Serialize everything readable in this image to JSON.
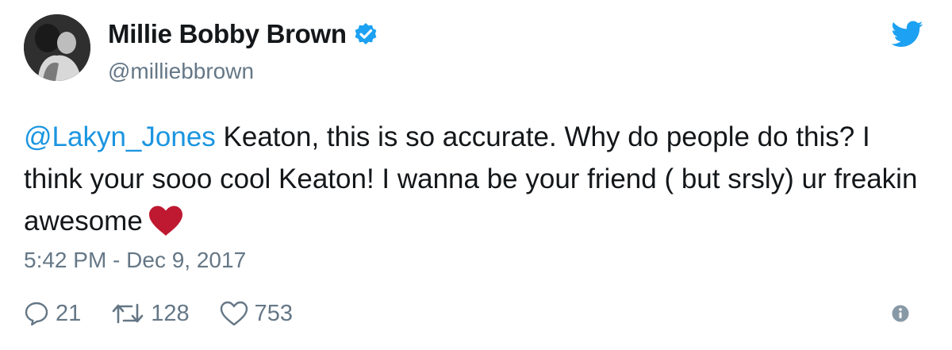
{
  "author": {
    "display_name": "Millie Bobby Brown",
    "handle": "@milliebbrown",
    "verified": true
  },
  "tweet": {
    "mention": "@Lakyn_Jones",
    "text": " Keaton, this is so accurate. Why do people do this? I think your sooo cool Keaton! I wanna be your friend ( but srsly) ur freakin awesome",
    "emoji": "red-heart",
    "timestamp": "5:42 PM - Dec 9, 2017"
  },
  "stats": {
    "replies": "21",
    "retweets": "128",
    "likes": "753"
  },
  "icons": {
    "brand": "twitter-bird-icon",
    "verified": "verified-badge-icon",
    "reply": "reply-icon",
    "retweet": "retweet-icon",
    "like": "heart-outline-icon",
    "info": "info-icon"
  },
  "colors": {
    "brand_blue": "#1da1f2",
    "mention_blue": "#1b95e0",
    "heart_red": "#be1931",
    "muted_gray": "#657786"
  }
}
